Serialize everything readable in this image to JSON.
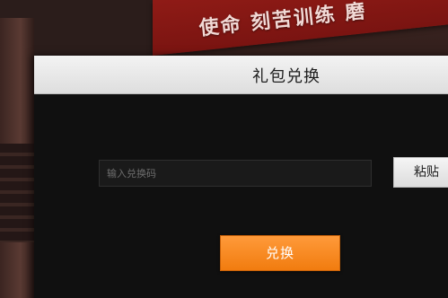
{
  "background": {
    "banner_text": "使命 刻苦训练 磨"
  },
  "dialog": {
    "title": "礼包兑换",
    "code_input": {
      "placeholder": "输入兑换码",
      "value": ""
    },
    "paste_label": "粘贴",
    "redeem_label": "兑换"
  },
  "colors": {
    "accent": "#f17c0f",
    "dialog_bg": "#101010",
    "header_bg": "#e8e8e8",
    "banner": "#8f1b16"
  }
}
